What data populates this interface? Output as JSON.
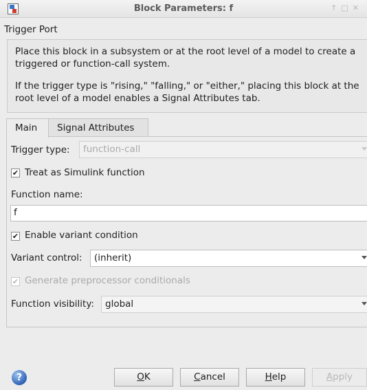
{
  "window": {
    "title": "Block Parameters: f"
  },
  "section": {
    "title": "Trigger Port"
  },
  "description": {
    "p1": "Place this block in a subsystem or at the root level of a model to create a triggered or function-call system.",
    "p2": "If the trigger type is \"rising,\" \"falling,\" or \"either,\" placing this block at the root level of a model enables a Signal Attributes tab."
  },
  "tabs": [
    {
      "label": "Main"
    },
    {
      "label": "Signal Attributes"
    }
  ],
  "main": {
    "trigger_type_label": "Trigger type:",
    "trigger_type_value": "function-call",
    "treat_as_function_label": "Treat as Simulink function",
    "treat_as_function_checked": true,
    "function_name_label": "Function name:",
    "function_name_value": "f",
    "enable_variant_label": "Enable variant condition",
    "enable_variant_checked": true,
    "variant_control_label": "Variant control:",
    "variant_control_value": "(inherit)",
    "generate_preprocessor_label": "Generate preprocessor conditionals",
    "generate_preprocessor_checked": true,
    "function_visibility_label": "Function visibility:",
    "function_visibility_value": "global"
  },
  "buttons": {
    "ok_mnemonic": "O",
    "ok_rest": "K",
    "cancel_mnemonic": "C",
    "cancel_rest": "ancel",
    "help_mnemonic": "H",
    "help_rest": "elp",
    "apply_mnemonic": "A",
    "apply_rest": "pply"
  },
  "icons": {
    "app": "simulink-block-icon",
    "help": "help-question-icon",
    "checkmark": "✔"
  }
}
